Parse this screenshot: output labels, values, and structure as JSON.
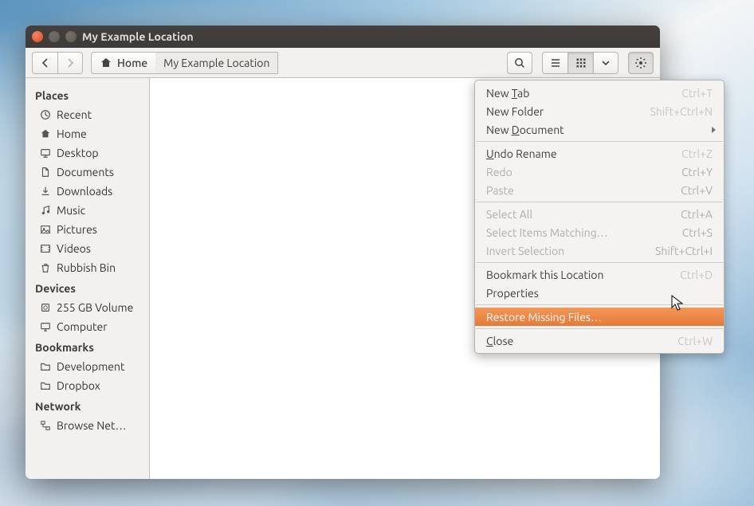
{
  "window": {
    "title": "My Example Location"
  },
  "toolbar": {
    "home_label": "Home",
    "location_label": "My Example Location"
  },
  "sidebar": {
    "sections": [
      {
        "heading": "Places",
        "items": [
          {
            "icon": "clock-icon",
            "label": "Recent"
          },
          {
            "icon": "home-icon",
            "label": "Home"
          },
          {
            "icon": "desktop-icon",
            "label": "Desktop"
          },
          {
            "icon": "document-icon",
            "label": "Documents"
          },
          {
            "icon": "download-icon",
            "label": "Downloads"
          },
          {
            "icon": "music-icon",
            "label": "Music"
          },
          {
            "icon": "pictures-icon",
            "label": "Pictures"
          },
          {
            "icon": "videos-icon",
            "label": "Videos"
          },
          {
            "icon": "trash-icon",
            "label": "Rubbish Bin"
          }
        ]
      },
      {
        "heading": "Devices",
        "items": [
          {
            "icon": "disk-icon",
            "label": "255 GB Volume"
          },
          {
            "icon": "computer-icon",
            "label": "Computer"
          }
        ]
      },
      {
        "heading": "Bookmarks",
        "items": [
          {
            "icon": "folder-icon",
            "label": "Development"
          },
          {
            "icon": "folder-icon",
            "label": "Dropbox"
          }
        ]
      },
      {
        "heading": "Network",
        "items": [
          {
            "icon": "network-icon",
            "label": "Browse Net…"
          }
        ]
      }
    ]
  },
  "menu": {
    "items": [
      {
        "label": "New Tab",
        "u": 4,
        "accel": "Ctrl+T",
        "disabled": false,
        "accel_disabled": true
      },
      {
        "label": "New Folder",
        "accel": "Shift+Ctrl+N",
        "disabled": false,
        "accel_disabled": true
      },
      {
        "label": "New Document",
        "u": 4,
        "submenu": true,
        "disabled": false
      },
      {
        "sep": true
      },
      {
        "label": "Undo Rename",
        "u": 0,
        "accel": "Ctrl+Z",
        "disabled": false,
        "accel_disabled": true
      },
      {
        "label": "Redo",
        "accel": "Ctrl+Y",
        "disabled": true
      },
      {
        "label": "Paste",
        "accel": "Ctrl+V",
        "disabled": true
      },
      {
        "sep": true
      },
      {
        "label": "Select All",
        "accel": "Ctrl+A",
        "disabled": true
      },
      {
        "label": "Select Items Matching…",
        "accel": "Ctrl+S",
        "disabled": true
      },
      {
        "label": "Invert Selection",
        "accel": "Shift+Ctrl+I",
        "disabled": true
      },
      {
        "sep": true
      },
      {
        "label": "Bookmark this Location",
        "accel": "Ctrl+D",
        "disabled": false,
        "accel_disabled": true
      },
      {
        "label": "Properties",
        "disabled": false
      },
      {
        "sep": true
      },
      {
        "label": "Restore Missing Files…",
        "highlight": true
      },
      {
        "sep": true
      },
      {
        "label": "Close",
        "u": 0,
        "accel": "Ctrl+W",
        "disabled": false,
        "accel_disabled": true
      }
    ]
  }
}
